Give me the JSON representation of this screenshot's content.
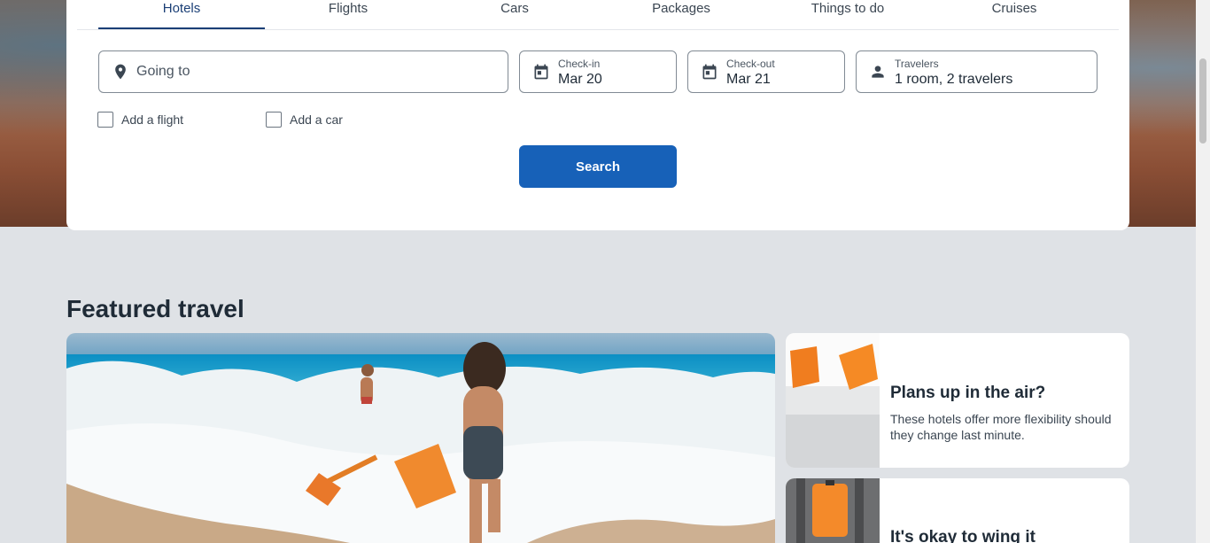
{
  "tabs": [
    {
      "label": "Hotels",
      "active": true
    },
    {
      "label": "Flights"
    },
    {
      "label": "Cars"
    },
    {
      "label": "Packages"
    },
    {
      "label": "Things to do"
    },
    {
      "label": "Cruises"
    }
  ],
  "search": {
    "destination_placeholder": "Going to",
    "checkin_label": "Check-in",
    "checkin_value": "Mar 20",
    "checkout_label": "Check-out",
    "checkout_value": "Mar 21",
    "travelers_label": "Travelers",
    "travelers_value": "1 room, 2 travelers",
    "add_flight_label": "Add a flight",
    "add_car_label": "Add a car",
    "search_button": "Search"
  },
  "featured": {
    "title": "Featured travel",
    "cards": [
      {
        "title": "Plans up in the air?",
        "description": "These hotels offer more flexibility should they change last minute."
      },
      {
        "title": "It's okay to wing it",
        "description": ""
      }
    ]
  },
  "colors": {
    "accent": "#1761b8",
    "active_tab": "#1b3f76",
    "page_bg": "#dfe2e6"
  },
  "icons": {
    "destination": "location-pin-icon",
    "checkin": "calendar-icon",
    "checkout": "calendar-icon",
    "travelers": "person-icon"
  }
}
